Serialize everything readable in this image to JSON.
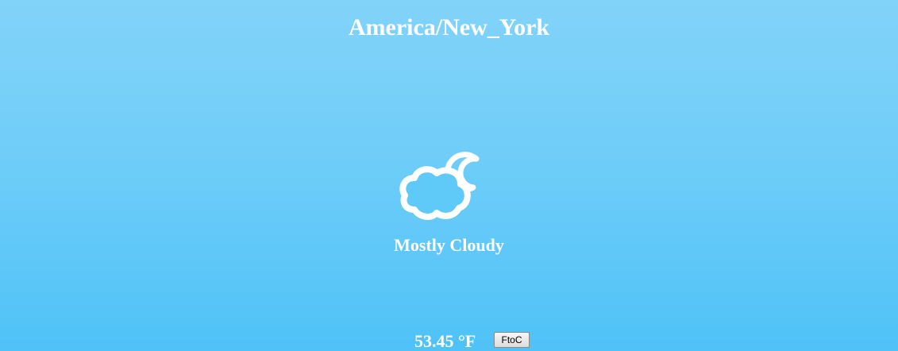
{
  "location": {
    "timezone": "America/New_York"
  },
  "weather": {
    "icon": "partly-cloudy-night-icon",
    "summary": "Mostly Cloudy",
    "temperature_display": "53.45 °F",
    "temperature_value": 53.45,
    "unit": "F"
  },
  "controls": {
    "toggle_label": "FtoC"
  },
  "colors": {
    "background_top": "#82d3f9",
    "background_bottom": "#4fc2f7",
    "text": "#ffffff"
  }
}
